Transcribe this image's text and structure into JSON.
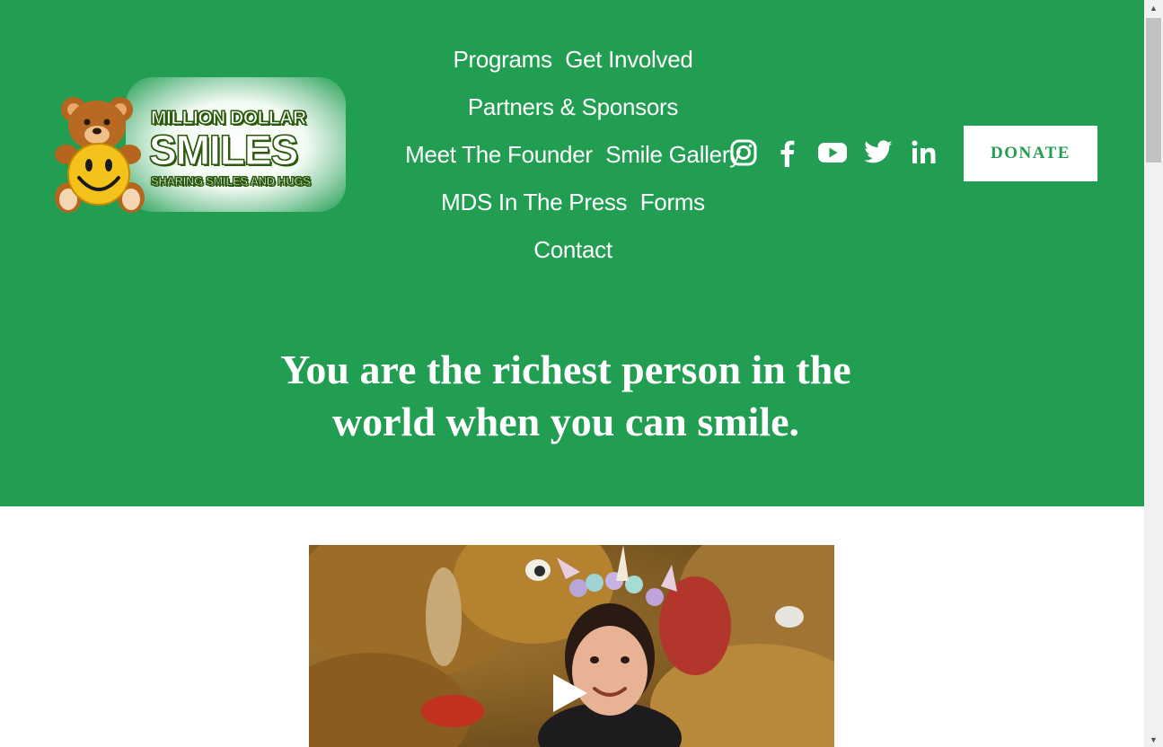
{
  "logo": {
    "line1": "MILLION DOLLAR",
    "line2": "SMILES",
    "line3": "SHARING SMILES AND HUGS"
  },
  "nav": {
    "rows": [
      [
        "Programs",
        "Get Involved"
      ],
      [
        "Partners & Sponsors"
      ],
      [
        "Meet The Founder",
        "Smile Gallery"
      ],
      [
        "MDS In The Press",
        "Forms"
      ],
      [
        "Contact"
      ]
    ]
  },
  "social": {
    "icons": [
      "instagram-icon",
      "facebook-icon",
      "youtube-icon",
      "twitter-icon",
      "linkedin-icon"
    ]
  },
  "donate": {
    "label": "DONATE"
  },
  "hero": {
    "headline_line1": "You are the richest person in the",
    "headline_line2": "world when you can smile."
  },
  "colors": {
    "brand_green": "#219e51",
    "white": "#ffffff"
  }
}
